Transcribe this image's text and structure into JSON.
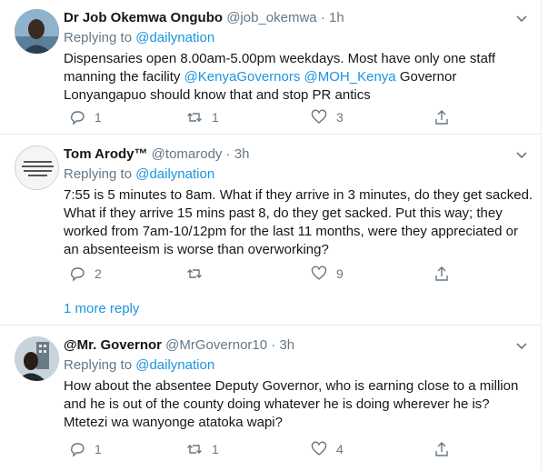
{
  "tweets": [
    {
      "name": "Dr Job Okemwa Ongubo",
      "handle": "@job_okemwa",
      "time": "1h",
      "replying_prefix": "Replying to",
      "replying_to": "@dailynation",
      "lines": [
        "Dispensaries open 8.00am-5.00pm weekdays. Most have only one staff",
        "manning the facility ",
        "Lonyangapuo should know that and stop PR antics"
      ],
      "mention_1": "@KenyaGovernors",
      "mention_2": "@MOH_Kenya",
      "line2_tail": " Governor",
      "reply_count": "1",
      "retweet_count": "1",
      "like_count": "3"
    },
    {
      "name": "Tom Arody™",
      "handle": "@tomarody",
      "time": "3h",
      "replying_prefix": "Replying to",
      "replying_to": "@dailynation",
      "lines": [
        "7:55 is 5 minutes to 8am. What if they arrive in 3 minutes, do they get sacked.",
        "What if they arrive 15 mins past 8, do they get sacked. Put this way; they",
        "worked from 7am-10/12pm for the last 11 months, were they appreciated or",
        "an absenteeism is worse than overworking?"
      ],
      "reply_count": "2",
      "retweet_count": "",
      "like_count": "9"
    },
    {
      "name": "@Mr. Governor",
      "handle": "@MrGovernor10",
      "time": "3h",
      "replying_prefix": "Replying to",
      "replying_to": "@dailynation",
      "lines": [
        "How about the absentee Deputy Governor, who is earning close to a million",
        "and he is out of the county doing whatever he is doing wherever he is?",
        "Mtetezi wa wanyonge atatoka wapi?"
      ],
      "reply_count": "1",
      "retweet_count": "1",
      "like_count": "4"
    }
  ],
  "more_replies": "1 more reply",
  "dot": "·",
  "colors": {
    "accent": "#1b95e0",
    "muted": "#657786",
    "text": "#14171a",
    "border": "#e6ecf0"
  }
}
